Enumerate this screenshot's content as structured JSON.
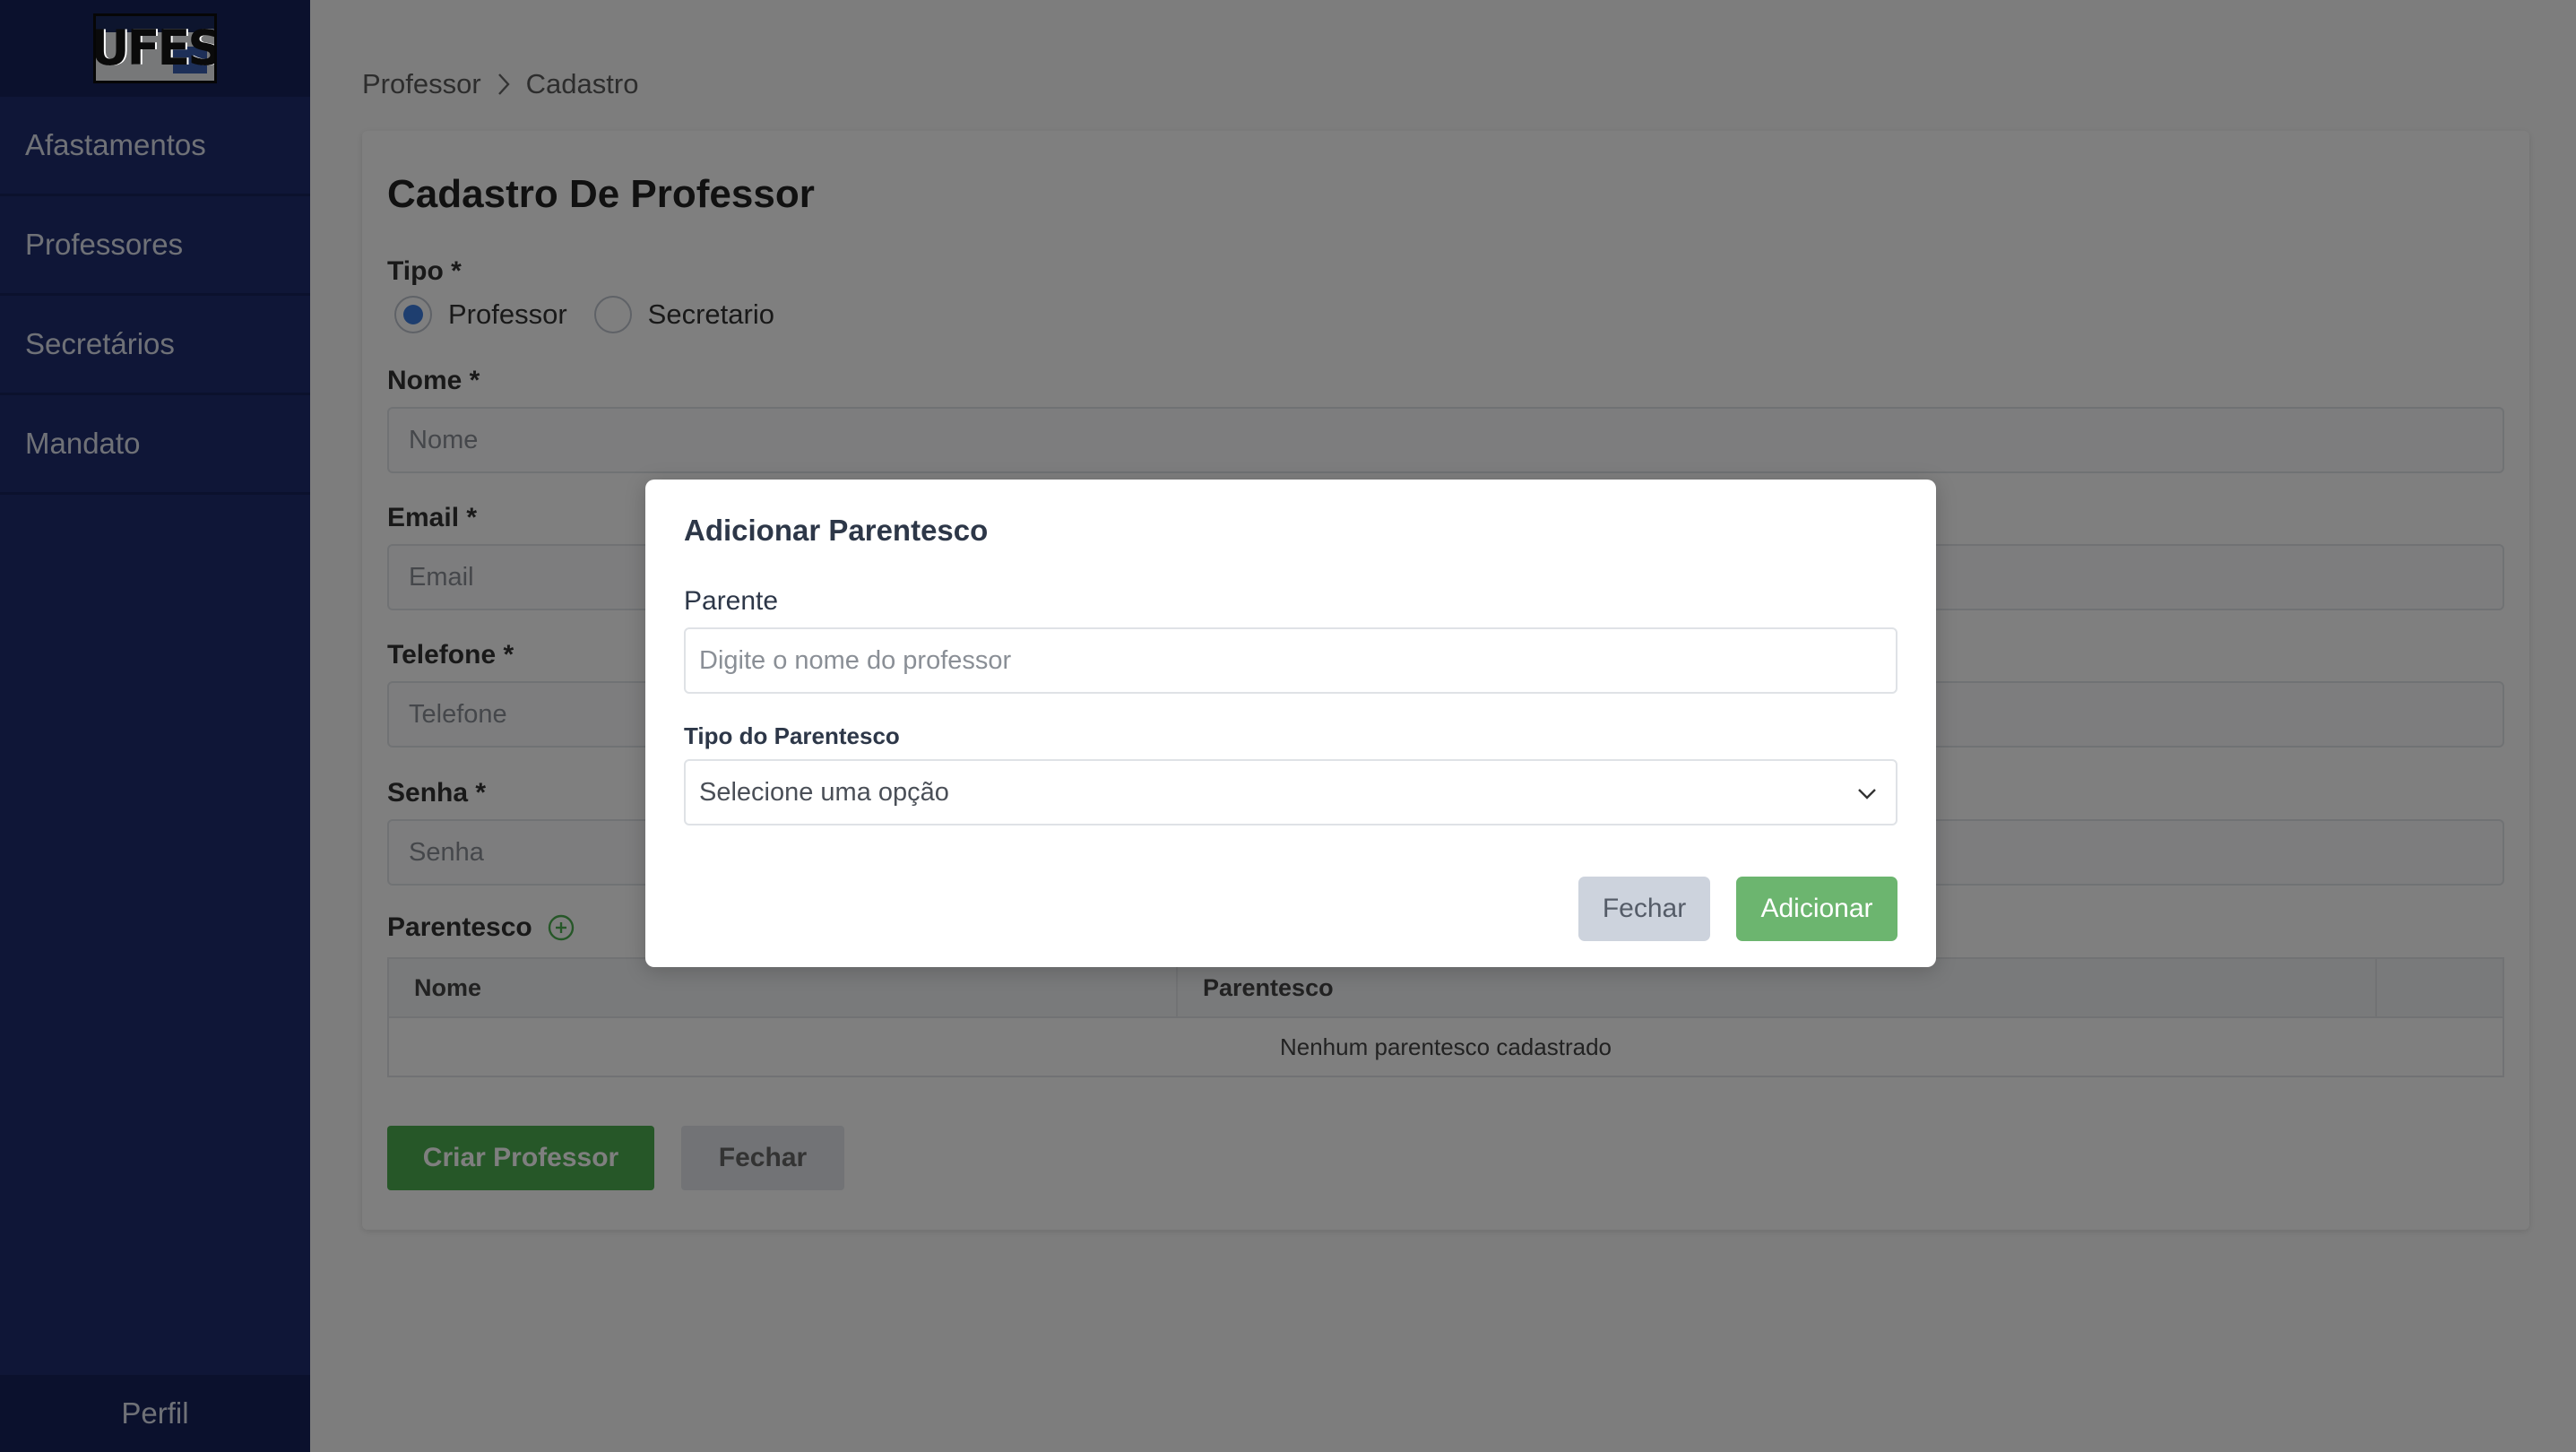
{
  "sidebar": {
    "logo_text": "UFES",
    "items": [
      {
        "label": "Afastamentos"
      },
      {
        "label": "Professores"
      },
      {
        "label": "Secretários"
      },
      {
        "label": "Mandato"
      }
    ],
    "footer_label": "Perfil"
  },
  "breadcrumb": {
    "items": [
      "Professor",
      "Cadastro"
    ],
    "separator_icon": "chevron-right-icon"
  },
  "form": {
    "title": "Cadastro De Professor",
    "tipo_label": "Tipo *",
    "tipo_options": [
      {
        "label": "Professor",
        "checked": true
      },
      {
        "label": "Secretario",
        "checked": false
      }
    ],
    "nome_label": "Nome *",
    "nome_placeholder": "Nome",
    "email_label": "Email *",
    "email_placeholder": "Email",
    "telefone_label": "Telefone *",
    "telefone_placeholder": "Telefone",
    "senha_label": "Senha *",
    "senha_placeholder": "Senha",
    "parentesco_label": "Parentesco",
    "add_icon": "plus-circle-icon",
    "table": {
      "headers": [
        "Nome",
        "Parentesco",
        ""
      ],
      "empty_message": "Nenhum parentesco cadastrado"
    },
    "create_button": "Criar Professor",
    "close_button": "Fechar"
  },
  "modal": {
    "title": "Adicionar Parentesco",
    "parente_label": "Parente",
    "parente_placeholder": "Digite o nome do professor",
    "tipo_label": "Tipo do Parentesco",
    "tipo_selected": "Selecione uma opção",
    "close_button": "Fechar",
    "add_button": "Adicionar"
  },
  "colors": {
    "sidebar_bg": "#1f2d6e",
    "sidebar_dark": "#16225a",
    "primary_green": "#4caf50",
    "modal_add_green": "#6cb56f",
    "radio_blue": "#3c7cdf",
    "overlay": "rgba(0,0,0,0.5)"
  }
}
